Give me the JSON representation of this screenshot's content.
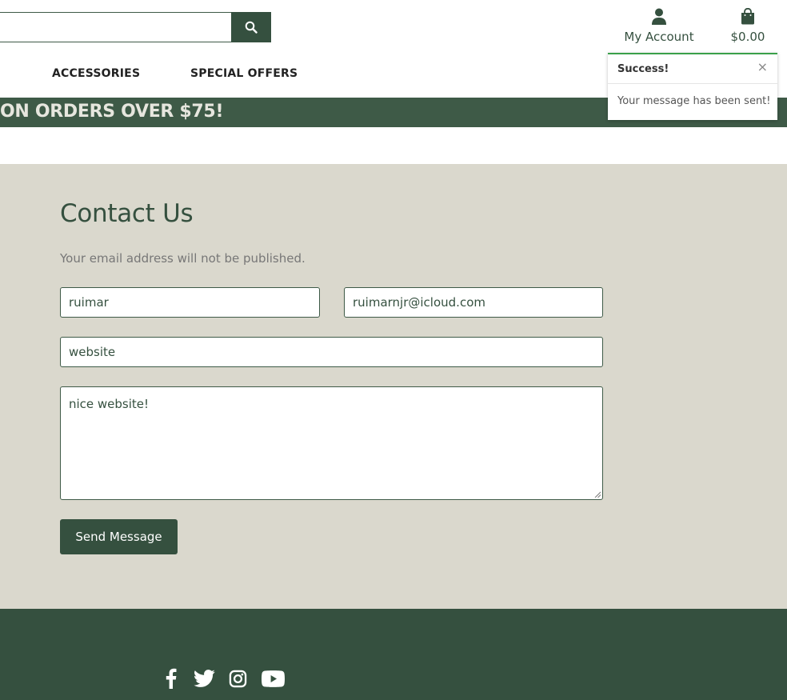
{
  "header": {
    "search": {
      "placeholder": "",
      "button_icon": "search-icon"
    },
    "account": {
      "label": "My Account",
      "icon": "user-icon"
    },
    "cart": {
      "label": "$0.00",
      "icon": "shopping-bag-icon"
    }
  },
  "nav": {
    "items": [
      {
        "label": "ACCESSORIES"
      },
      {
        "label": "SPECIAL OFFERS"
      }
    ]
  },
  "banner": {
    "text": "ON ORDERS OVER $75!"
  },
  "toast": {
    "title": "Success!",
    "close_label": "×",
    "message": "Your message has been sent!"
  },
  "contact": {
    "title": "Contact Us",
    "note": "Your email address will not be published.",
    "name_value": "ruimar",
    "email_value": "ruimarnjr@icloud.com",
    "website_value": "website",
    "message_value": "nice website!",
    "submit_label": "Send Message"
  },
  "footer": {
    "social_icons": [
      "facebook-icon",
      "twitter-icon",
      "instagram-icon",
      "youtube-icon"
    ]
  },
  "colors": {
    "brand_green": "#35503f",
    "banner_green": "#3e5a47",
    "section_bg": "#dad8cd",
    "success_accent": "#3aa04a"
  }
}
